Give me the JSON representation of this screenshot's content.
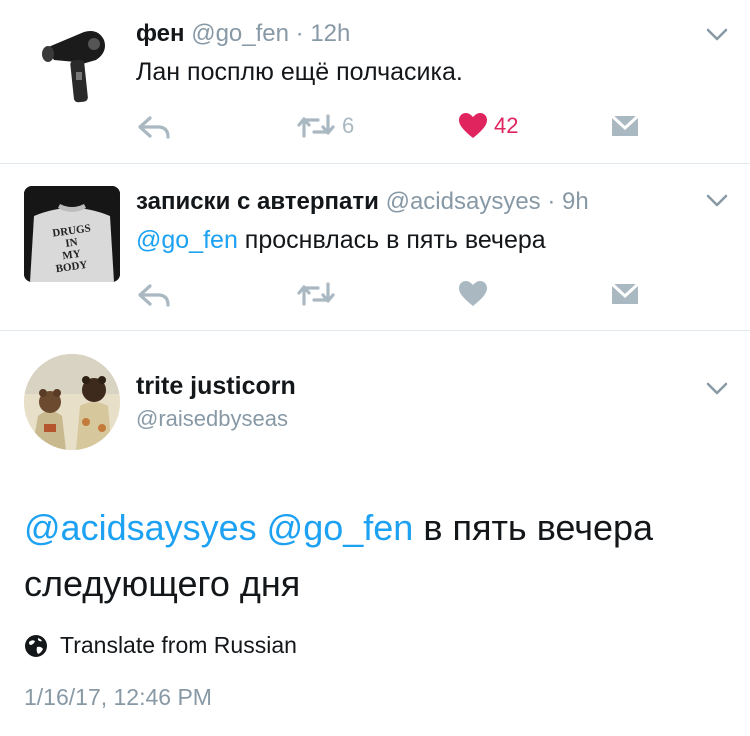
{
  "tweets": [
    {
      "name": "фен",
      "handle": "@go_fen",
      "time": "12h",
      "text": "Лан посплю ещё полчасика.",
      "retweets": "6",
      "likes": "42",
      "liked": true
    },
    {
      "name": "записки с автерпати",
      "handle": "@acidsaysyes",
      "time": "9h",
      "mention": "@go_fen",
      "text": "проснвлась в пять вечера",
      "avatar_text": [
        "DRUGS",
        "IN",
        "MY",
        "BODY"
      ]
    }
  ],
  "detail": {
    "name": "trite justicorn",
    "handle": "@raisedbyseas",
    "mention1": "@acidsaysyes",
    "mention2": "@go_fen",
    "text_line1": "в пять вечера",
    "text_line2": "следующего дня",
    "translate": "Translate from Russian",
    "timestamp": "1/16/17, 12:46 PM"
  },
  "colors": {
    "link": "#1da1f2",
    "like_active": "#e0245e",
    "icon_grey": "#aab8c2",
    "divider": "#e1e8ed"
  },
  "icons": [
    "hair-dryer-avatar",
    "reply-icon",
    "retweet-icon",
    "heart-icon",
    "dm-icon",
    "chevron-down-icon",
    "globe-icon"
  ]
}
